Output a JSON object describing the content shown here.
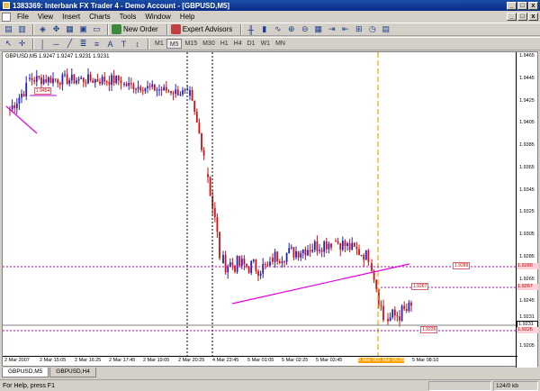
{
  "window": {
    "title": "1383369: Interbank FX Trader 4 - Demo Account - [GBPUSD,M5]",
    "controls": [
      "_",
      "□",
      "x"
    ]
  },
  "menu": {
    "items": [
      "File",
      "View",
      "Insert",
      "Charts",
      "Tools",
      "Window",
      "Help"
    ],
    "mdi_controls": [
      "_",
      "□",
      "x"
    ]
  },
  "toolbar": {
    "new_order": "New Order",
    "expert_advisors": "Expert Advisors"
  },
  "timeframes": {
    "items": [
      "M1",
      "M5",
      "M15",
      "M30",
      "H1",
      "H4",
      "D1",
      "W1",
      "MN"
    ],
    "active": "M5"
  },
  "chart": {
    "header": "GBPUSD,M5  1.9247 1.9247 1.9231 1.9231",
    "price_labels": [
      "1.9465",
      "1.9445",
      "1.9425",
      "1.9405",
      "1.9385",
      "1.9365",
      "1.9345",
      "1.9325",
      "1.9305",
      "1.9285",
      "1.9265",
      "1.9245",
      "1.9231",
      "1.9225",
      "1.9205"
    ],
    "time_labels": [
      "2 Mar 2007",
      "2 Mar 15:05",
      "2 Mar 16:25",
      "2 Mar 17:45",
      "2 Mar 19:05",
      "2 Mar 20:25",
      "4 Mar 23:45",
      "5 Mar 01:05",
      "5 Mar 02:25",
      "5 Mar 03:45",
      "5 Mar 05:05",
      "5 Mar 06:25",
      "5 Mar 08:10"
    ],
    "level_tags": {
      "top_left": "1.9454",
      "upper": "1.9289",
      "middle": "1.9267",
      "lower": "1.9226"
    },
    "axis_tags": {
      "upper": "1.9289",
      "middle": "1.9267",
      "bid": "1.9231",
      "lower": "1.9226"
    },
    "colors": {
      "bull": "#2020c0",
      "bear": "#d01010",
      "trendline": "#e000e0",
      "level_line": "#c000c0",
      "bid_line": "#808080",
      "vline_black": "#000000",
      "vline_orange": "#ffa000"
    }
  },
  "tabs": {
    "items": [
      "GBPUSD,M5",
      "GBPUSD,H4"
    ],
    "active": "GBPUSD,M5"
  },
  "status": {
    "help": "For Help, press F1",
    "traffic": "124/0 kb"
  }
}
